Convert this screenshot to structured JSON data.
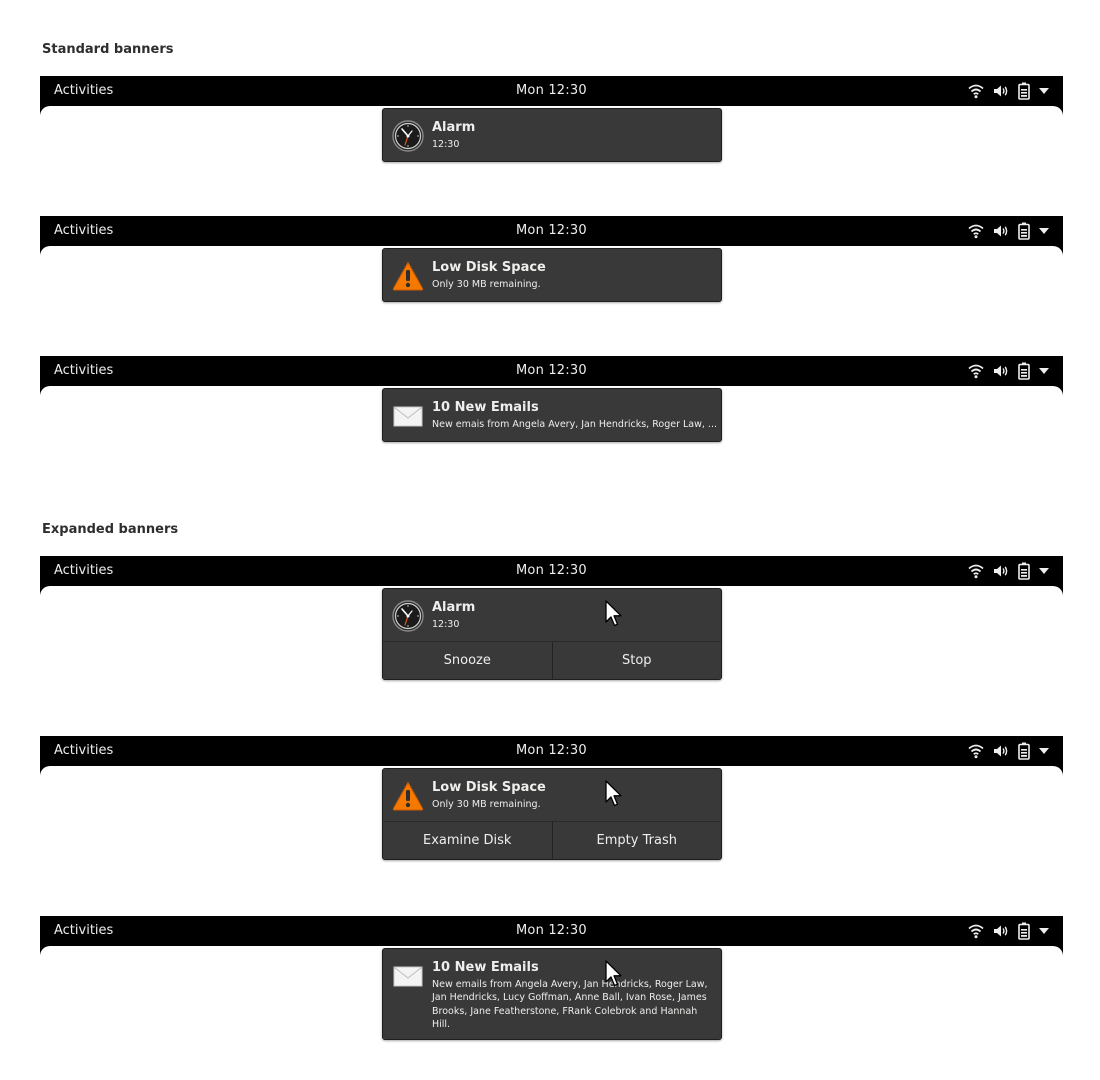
{
  "sections": {
    "standard_title": "Standard banners",
    "expanded_title": "Expanded banners"
  },
  "topbar": {
    "activities": "Activities",
    "clock": "Mon 12:30",
    "icons": [
      "wifi-icon",
      "volume-icon",
      "battery-icon",
      "menu-arrow-icon"
    ]
  },
  "standard": {
    "alarm": {
      "title": "Alarm",
      "body": "12:30",
      "icon": "clock-icon"
    },
    "disk": {
      "title": "Low Disk Space",
      "body": "Only 30 MB remaining.",
      "icon": "warning-icon"
    },
    "email": {
      "title": "10 New Emails",
      "body": "New emais from Angela Avery, Jan Hendricks, Roger Law, ...",
      "icon": "envelope-icon"
    }
  },
  "expanded": {
    "alarm": {
      "title": "Alarm",
      "body": "12:30",
      "icon": "clock-icon",
      "action1": "Snooze",
      "action2": "Stop"
    },
    "disk": {
      "title": "Low Disk Space",
      "body": "Only 30 MB remaining.",
      "icon": "warning-icon",
      "action1": "Examine Disk",
      "action2": "Empty Trash"
    },
    "email": {
      "title": "10 New Emails",
      "body": "New emails from Angela Avery, Jan Hendricks, Roger Law, Jan Hendricks, Lucy Goffman, Anne Ball, Ivan Rose, James Brooks, Jane Featherstone, FRank Colebrok and Hannah Hill.",
      "icon": "envelope-icon"
    }
  },
  "colors": {
    "topbar": "#000000",
    "banner": "#393939",
    "text": "#eeeeec",
    "warning": "#f57900"
  }
}
